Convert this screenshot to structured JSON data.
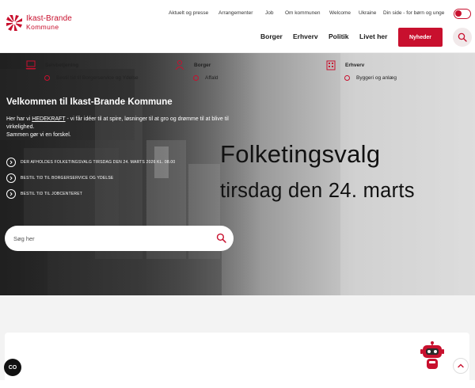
{
  "brand": {
    "name": "Ikast-Brande",
    "sub": "Kommune",
    "accent": "#c8102e"
  },
  "topnav": [
    "Aktuelt og presse",
    "Arrangementer",
    "Job",
    "Om kommunen",
    "Welcome",
    "Ukraine",
    "Din side - for børn og unge"
  ],
  "mainnav": [
    "Borger",
    "Erhverv",
    "Politik",
    "Livet her"
  ],
  "header": {
    "news_button": "Nyheder"
  },
  "hero": {
    "title": "Velkommen til Ikast-Brande Kommune",
    "text_prefix": "Her har vi ",
    "text_highlight": "HEDEKRAFT",
    "text_rest": " - vi får idéer til at spire, løsninger til at gro og drømme til at blive til virkelighed.",
    "text_line2": "Sammen gør vi en forskel.",
    "links": [
      "DER AFHOLDES FOLKETINGSVALG TIRSDAG DEN 24. MARTS 2026 KL. 08.00",
      "BESTIL TID TIL BORGERSERVICE OG YDELSE",
      "BESTIL TID TIL JOBCENTERET"
    ],
    "poster_line1": "Folketingsvalg",
    "poster_line2": "tirsdag den 24. marts",
    "search_placeholder": "Søg her"
  },
  "columns": [
    {
      "heading": "Selvbetjening",
      "icon": "laptop-icon",
      "first_item": "Bestil tid til Borgerservice og Ydelse"
    },
    {
      "heading": "Borger",
      "icon": "people-icon",
      "first_item": "Affald"
    },
    {
      "heading": "Erhverv",
      "icon": "building-icon",
      "first_item": "Byggeri og anlæg"
    }
  ],
  "widgets": {
    "cookie_label": "CO"
  }
}
